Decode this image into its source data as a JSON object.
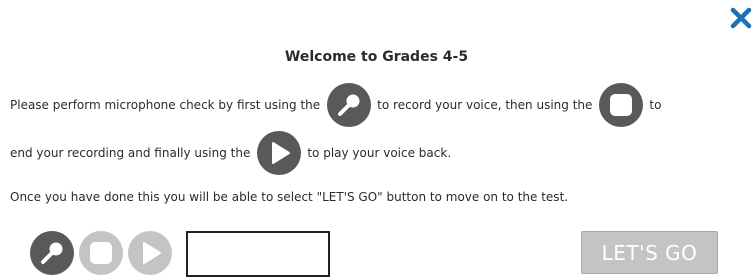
{
  "dialog": {
    "title": "Welcome to Grades 4-5",
    "instructions": {
      "line1_part1": "Please perform microphone check by first using the",
      "line1_part2": "to record your voice, then using the",
      "line1_part3": "to",
      "line2_part1": "end your recording and finally using the",
      "line2_part2": "to play your voice back.",
      "line3": "Once you have done this you will be able to select \"LET'S GO\" button to move on to the test."
    },
    "close_icon": "close-x-icon",
    "record_icon": "microphone-icon",
    "stop_icon": "stop-square-icon",
    "play_icon": "play-triangle-icon",
    "controls": {
      "record_state": "enabled",
      "stop_state": "disabled",
      "play_state": "disabled",
      "status_text": ""
    },
    "go_button": {
      "label": "LET'S GO",
      "state": "disabled"
    },
    "colors": {
      "close_x": "#1f6fb5",
      "button_active": "#595959",
      "button_disabled": "#c4c4c4",
      "text": "#2b2b2b"
    }
  }
}
